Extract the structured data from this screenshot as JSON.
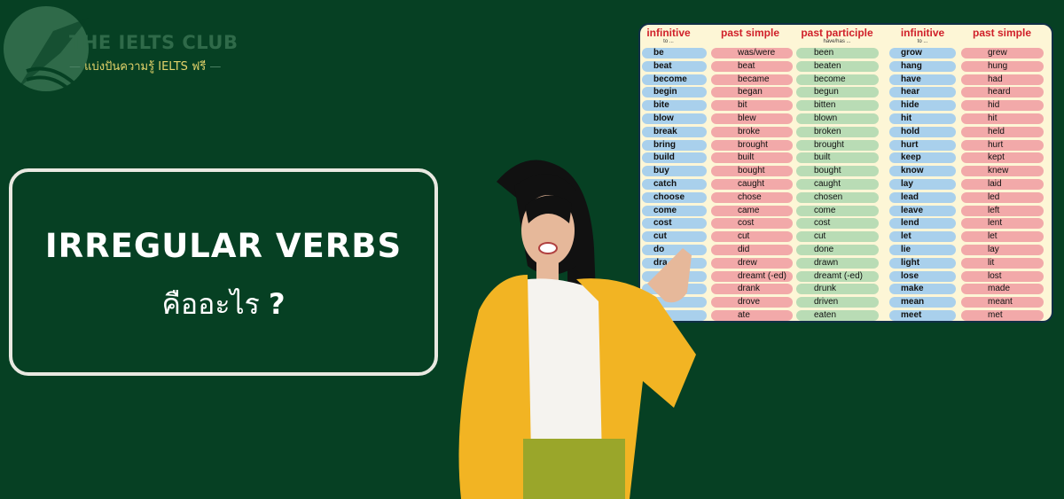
{
  "logo": {
    "title": "THE IELTS CLUB",
    "subtitle": "แบ่งปันความรู้ IELTS ฟรี"
  },
  "headline": {
    "title": "IRREGULAR VERBS",
    "subtitle": "คืออะไร",
    "mark": "?"
  },
  "colors": {
    "background": "#064023",
    "header_text": "#d0202a",
    "infinitive": "#a9d0ec",
    "past_simple": "#f2a9a9",
    "past_participle": "#b9dcb5"
  },
  "verb_table": {
    "headers": [
      {
        "label": "infinitive",
        "sub": "to ..."
      },
      {
        "label": "past simple",
        "sub": ""
      },
      {
        "label": "past participle",
        "sub": "have/has ..."
      },
      {
        "label": "infinitive",
        "sub": "to ..."
      },
      {
        "label": "past simple",
        "sub": ""
      }
    ],
    "rows": [
      [
        "be",
        "was/were",
        "been",
        "grow",
        "grew"
      ],
      [
        "beat",
        "beat",
        "beaten",
        "hang",
        "hung"
      ],
      [
        "become",
        "became",
        "become",
        "have",
        "had"
      ],
      [
        "begin",
        "began",
        "begun",
        "hear",
        "heard"
      ],
      [
        "bite",
        "bit",
        "bitten",
        "hide",
        "hid"
      ],
      [
        "blow",
        "blew",
        "blown",
        "hit",
        "hit"
      ],
      [
        "break",
        "broke",
        "broken",
        "hold",
        "held"
      ],
      [
        "bring",
        "brought",
        "brought",
        "hurt",
        "hurt"
      ],
      [
        "build",
        "built",
        "built",
        "keep",
        "kept"
      ],
      [
        "buy",
        "bought",
        "bought",
        "know",
        "knew"
      ],
      [
        "catch",
        "caught",
        "caught",
        "lay",
        "laid"
      ],
      [
        "choose",
        "chose",
        "chosen",
        "lead",
        "led"
      ],
      [
        "come",
        "came",
        "come",
        "leave",
        "left"
      ],
      [
        "cost",
        "cost",
        "cost",
        "lend",
        "lent"
      ],
      [
        "cut",
        "cut",
        "cut",
        "let",
        "let"
      ],
      [
        "do",
        "did",
        "done",
        "lie",
        "lay"
      ],
      [
        "dra",
        "drew",
        "drawn",
        "light",
        "lit"
      ],
      [
        "",
        "dreamt (-ed)",
        "dreamt (-ed)",
        "lose",
        "lost"
      ],
      [
        "",
        "drank",
        "drunk",
        "make",
        "made"
      ],
      [
        "",
        "drove",
        "driven",
        "mean",
        "meant"
      ],
      [
        "",
        "ate",
        "eaten",
        "meet",
        "met"
      ]
    ]
  }
}
